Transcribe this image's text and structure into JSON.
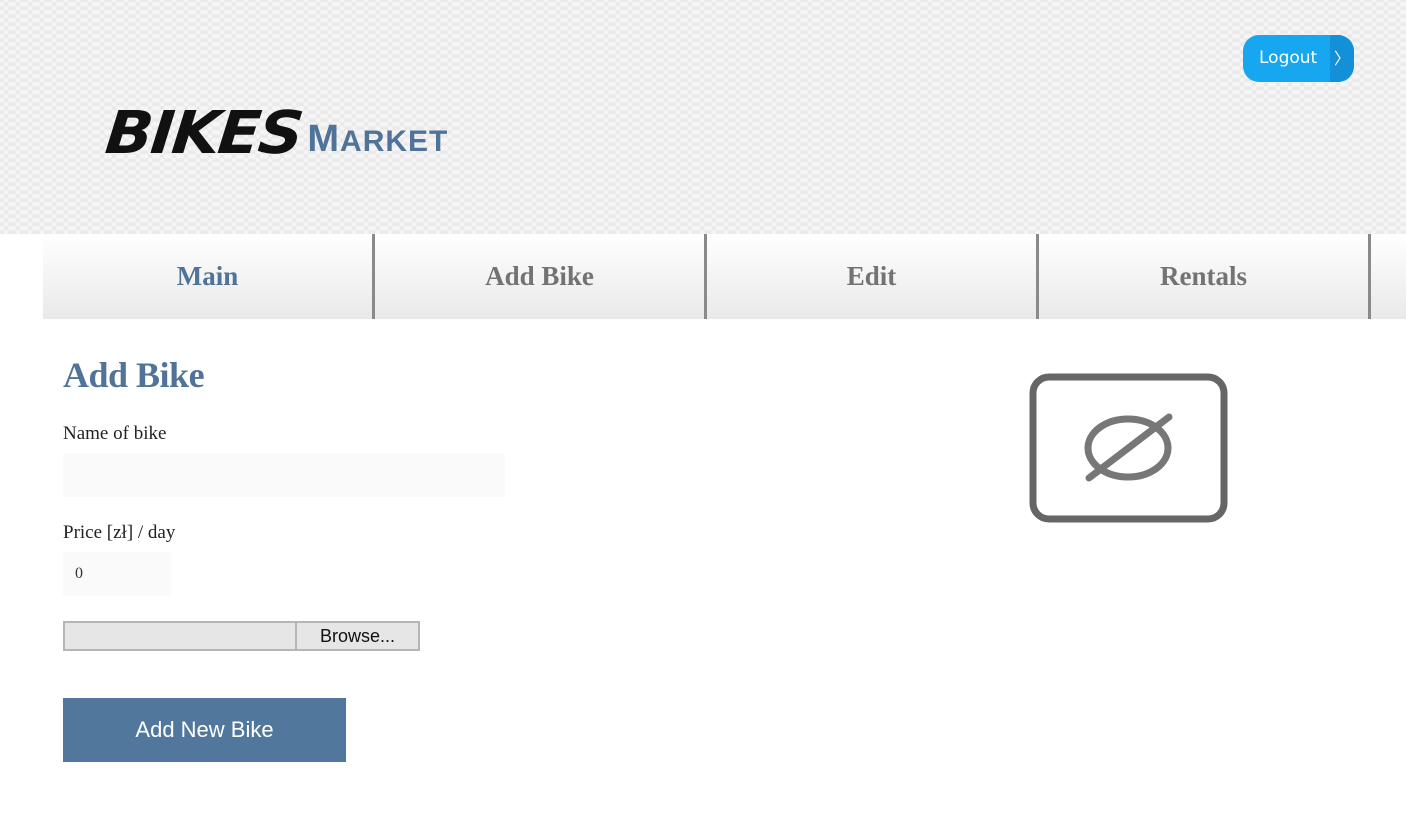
{
  "header": {
    "logo": {
      "brand_bold": "BIKES",
      "brand_rest_cap": "M",
      "brand_rest_small": "ARKET"
    },
    "logout_label": "Logout",
    "logout_arrow": "〉"
  },
  "nav": {
    "items": [
      {
        "label": "Main",
        "active": true
      },
      {
        "label": "Add Bike",
        "active": false
      },
      {
        "label": "Edit",
        "active": false
      },
      {
        "label": "Rentals",
        "active": false
      }
    ]
  },
  "form": {
    "title": "Add Bike",
    "name_label": "Name of bike",
    "name_value": "",
    "price_label": "Price [zł] / day",
    "price_value": "0",
    "browse_label": "Browse...",
    "submit_label": "Add New Bike"
  },
  "preview": {
    "icon": "no-image-icon"
  },
  "colors": {
    "accent": "#50739a",
    "logout": "#17a7f0",
    "nav_text": "#737373"
  }
}
